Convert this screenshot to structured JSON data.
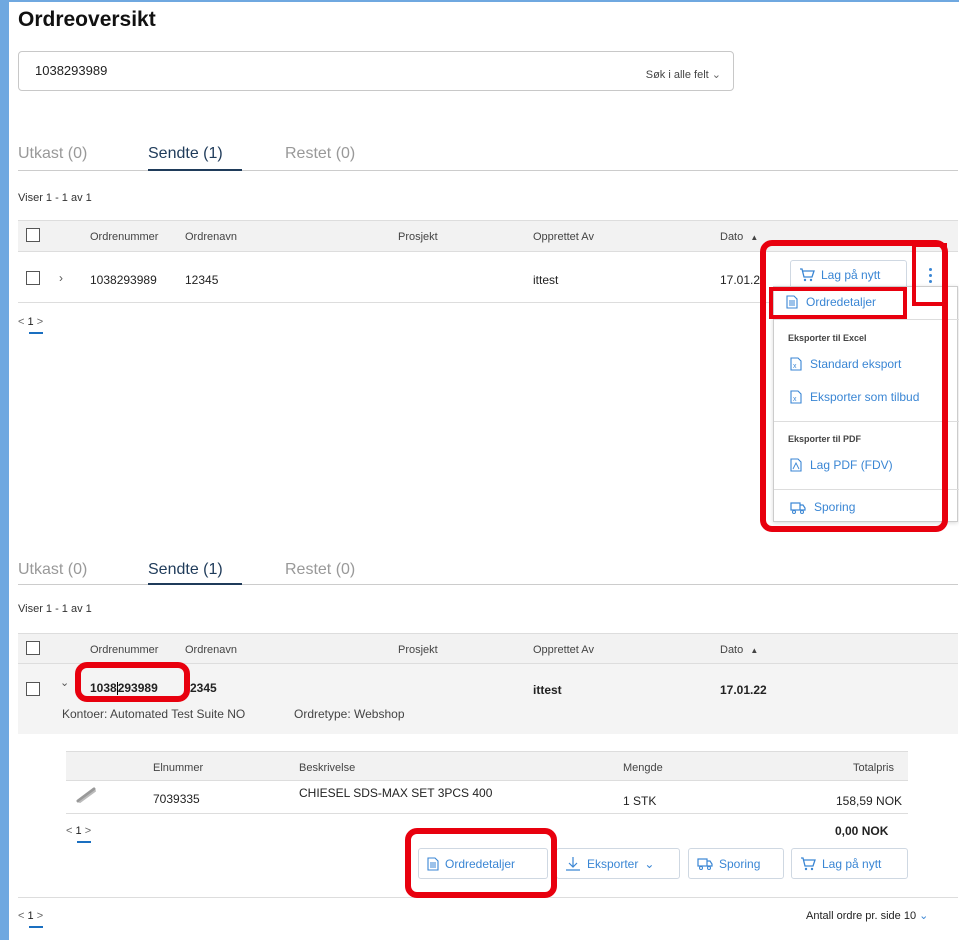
{
  "page": {
    "title": "Ordreoversikt"
  },
  "search": {
    "value": "1038293989",
    "scope_label": "Søk i alle felt"
  },
  "tabs": [
    {
      "label": "Utkast (0)",
      "active": false
    },
    {
      "label": "Sendte (1)",
      "active": true
    },
    {
      "label": "Restet (0)",
      "active": false
    }
  ],
  "result_count": "Viser 1 - 1 av 1",
  "columns": {
    "order_number": "Ordrenummer",
    "order_name": "Ordrenavn",
    "project": "Prosjekt",
    "created_by": "Opprettet Av",
    "date": "Dato"
  },
  "sort_indicator": "▲",
  "order_row": {
    "order_number": "1038293989",
    "order_name": "12345",
    "project": "",
    "created_by": "ittest",
    "date_truncated": "17.01.2",
    "date": "17.01.22"
  },
  "expanded": {
    "customer_label": "Kontoer: Automated Test Suite NO",
    "order_type": "Ordretype: Webshop",
    "order_number_part1": "1038",
    "order_number_part2": "293989",
    "order_name_visible": "2345"
  },
  "pagination": {
    "prev": "<",
    "page": "1",
    "next": ">"
  },
  "actions": {
    "reorder": "Lag på nytt",
    "more_icon": "more-vertical-icon"
  },
  "dropdown": {
    "order_details": "Ordredetaljer",
    "excel_header": "Eksporter til Excel",
    "standard_export": "Standard eksport",
    "export_as_quote": "Eksporter som tilbud",
    "pdf_header": "Eksporter til PDF",
    "make_pdf": "Lag PDF (FDV)",
    "tracking": "Sporing"
  },
  "lines": {
    "headers": {
      "el_number": "Elnummer",
      "description": "Beskrivelse",
      "quantity": "Mengde",
      "total": "Totalpris"
    },
    "rows": [
      {
        "el_number": "7039335",
        "description": "CHIESEL SDS-MAX SET 3PCS 400",
        "quantity": "1 STK",
        "total": "158,59 NOK"
      }
    ],
    "sum": "0,00 NOK"
  },
  "bottom_actions": {
    "details": "Ordredetaljer",
    "export": "Eksporter",
    "tracking": "Sporing",
    "reorder": "Lag på nytt"
  },
  "per_page": {
    "label": "Antall ordre pr. side",
    "value": "10"
  },
  "colors": {
    "accent": "#3a86d4",
    "highlight": "#e8000e",
    "tab_active": "#1f3b5a"
  }
}
